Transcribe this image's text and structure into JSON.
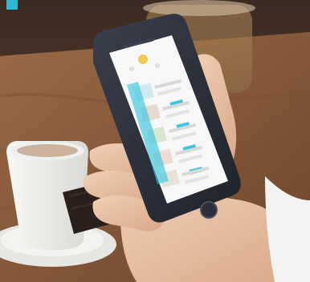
{
  "scene": {
    "kind": "photo",
    "subject": "hand-holding-smartphone",
    "accent_color": "#2fb7d6",
    "phone_body_color": "#2b2f3a",
    "table_color": "#8a5a34",
    "cup_color": "#f4f4f2",
    "skin_color": "#e9c2a5"
  },
  "phone_screen": {
    "background": "#f7f7f7",
    "logo_color": "#f5c84a",
    "button_color": "#31c3e0"
  }
}
